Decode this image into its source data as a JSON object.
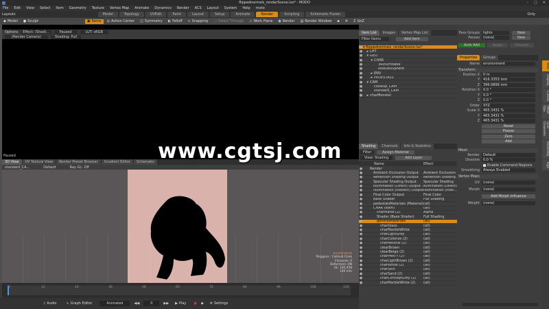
{
  "window": {
    "title": "flippednormals_renderScene.lxo* - MODO",
    "layouts_label": "Layouts",
    "layout_name": "Only",
    "controls": [
      "–",
      "□",
      "✕"
    ]
  },
  "menu": [
    "File",
    "Edit",
    "View",
    "Select",
    "Item",
    "Geometry",
    "Texture",
    "Vertex Map",
    "Animate",
    "Dynamics",
    "Render",
    "ACS",
    "Layout",
    "System",
    "Help",
    "moto"
  ],
  "layout_tabs": [
    "Model",
    "Topology",
    "UVEdit",
    "Paint",
    "Layout",
    "Setup",
    "Animate",
    "Render",
    "Scripting",
    "Schematic Fusion"
  ],
  "layout_tabs_active": "Render",
  "toolbar": {
    "model": "Model",
    "sculpt": "Sculpt",
    "items": "Items",
    "action_center": "Action Center",
    "symmetry": "Symmetry",
    "falloff": "Falloff",
    "snapping": "Snapping",
    "select_through": "Select Through",
    "work_plane": "Work Plane",
    "render": "Render",
    "render_window": "Render Window",
    "gof": "GoZ"
  },
  "render_view": {
    "options": "Options",
    "effect": "Effect: (Shadi...",
    "paused": "Paused",
    "lut": "LUT: sRGB",
    "camera": "(Render Camera)",
    "shading": "Shading: Full",
    "status": "Paused"
  },
  "watermark": "www.cgtsj.com",
  "view3d": {
    "tabs": [
      "3D View",
      "UV Texture View",
      "Render Preset Browser",
      "Gradient Editor",
      "Schematic"
    ],
    "cam": "standard_CA...",
    "default": "Default",
    "ray": "Ray GL: Off",
    "info": [
      "environment",
      "Polygons : Catmull-Clark",
      "Channels: 0",
      "Deformers: ON",
      "GL: 195,458",
      "100 mm"
    ]
  },
  "timeline": {
    "ticks": [
      "0",
      "12",
      "24",
      "36",
      "48",
      "60",
      "72",
      "84",
      "96",
      "108",
      "120"
    ],
    "audio": "Audio",
    "graph_editor": "Graph Editor",
    "animated": "Animated",
    "frame": "0",
    "play": "Play",
    "settings": "Settings"
  },
  "item_list": {
    "tabs": [
      "Item List",
      "Images",
      "Vertex Map List"
    ],
    "filter": "Filter Items",
    "add_item": "Add Item",
    "rows": [
      {
        "label": "flippednormals_renderScene.lxo*",
        "depth": 0,
        "arrow": "▾",
        "selected": true
      },
      {
        "label": "LHT",
        "depth": 1,
        "arrow": "▸",
        "selected": false
      },
      {
        "label": "GEO",
        "depth": 1,
        "arrow": "▾",
        "selected": false
      },
      {
        "label": "CHAR",
        "depth": 2,
        "arrow": "▾",
        "selected": false
      },
      {
        "label": "360turntable",
        "depth": 3,
        "arrow": "",
        "selected": false
      },
      {
        "label": "lookDevSphere",
        "depth": 3,
        "arrow": "",
        "selected": false
      },
      {
        "label": "ENV",
        "depth": 2,
        "arrow": "▸",
        "selected": false
      },
      {
        "label": "PEDESTALS",
        "depth": 2,
        "arrow": "▸",
        "selected": false
      },
      {
        "label": "CAM",
        "depth": 1,
        "arrow": "▾",
        "selected": false
      },
      {
        "label": "closeup_CAM",
        "depth": 2,
        "arrow": "",
        "selected": false
      },
      {
        "label": "standard_CAM",
        "depth": 2,
        "arrow": "",
        "selected": false
      },
      {
        "label": "charMonster",
        "depth": 1,
        "arrow": "▸",
        "selected": false
      }
    ]
  },
  "shading": {
    "tabs": [
      "Shading",
      "Channels",
      "Info & Statistics"
    ],
    "filter": "Filter",
    "view": "View: Shading",
    "assign_material": "Assign Material",
    "add_layer": "Add Layer",
    "col_name": "Name",
    "col_effect": "Effect",
    "rows": [
      {
        "name": "Render",
        "effect": "",
        "depth": 0,
        "sel": false
      },
      {
        "name": "Ambient Occlusion Output",
        "effect": "Ambient Occlusion",
        "depth": 1,
        "sel": false
      },
      {
        "name": "Reflection Shading Output",
        "effect": "Reflection Shading",
        "depth": 1,
        "sel": false
      },
      {
        "name": "Specular Shading Output",
        "effect": "Specular Shading",
        "depth": 1,
        "sel": false
      },
      {
        "name": "Illumination (Direct) Output",
        "effect": "Illumination (Direct)",
        "depth": 1,
        "sel": false
      },
      {
        "name": "Illumination (Indirect) Output",
        "effect": "Illumination (Indir...",
        "depth": 1,
        "sel": false
      },
      {
        "name": "Final Color Output",
        "effect": "Final Color",
        "depth": 1,
        "sel": false
      },
      {
        "name": "Base Shader",
        "effect": "Full Shading",
        "depth": 1,
        "sel": false
      },
      {
        "name": "pedestalsMaterials (Material)",
        "effect": "(all)",
        "depth": 1,
        "sel": false
      },
      {
        "name": "CHAR (Item)",
        "effect": "(all)",
        "depth": 1,
        "sel": false
      },
      {
        "name": "charMatte (2)",
        "effect": "Alpha",
        "depth": 2,
        "sel": false
      },
      {
        "name": "Shader (Base Shader)",
        "effect": "Full Shading",
        "depth": 2,
        "sel": false
      },
      {
        "name": "generalMaterials",
        "effect": "(all)",
        "depth": 2,
        "sel": true
      },
      {
        "name": "charGlass",
        "effect": "(all)",
        "depth": 3,
        "sel": false
      },
      {
        "name": "charMarbleWhite",
        "effect": "(all)",
        "depth": 3,
        "sel": false
      },
      {
        "name": "charLightGrey",
        "effect": "(all)",
        "depth": 3,
        "sel": false
      },
      {
        "name": "charColorize (2)",
        "effect": "(all)",
        "depth": 3,
        "sel": false
      },
      {
        "name": "charNeutral (2)",
        "effect": "(all)",
        "depth": 3,
        "sel": false
      },
      {
        "name": "clearBrown",
        "effect": "(all)",
        "depth": 3,
        "sel": false
      },
      {
        "name": "clearBeige (2)",
        "effect": "(all)",
        "depth": 3,
        "sel": false
      },
      {
        "name": "charPARTY (2)",
        "effect": "(all)",
        "depth": 3,
        "sel": false
      },
      {
        "name": "charLightBrown (2)",
        "effect": "(all)",
        "depth": 3,
        "sel": false
      },
      {
        "name": "charWhite (2)",
        "effect": "(all)",
        "depth": 3,
        "sel": false
      },
      {
        "name": "charSkin",
        "effect": "(all)",
        "depth": 3,
        "sel": false
      },
      {
        "name": "charSand (2)",
        "effect": "(all)",
        "depth": 3,
        "sel": false
      },
      {
        "name": "charConceptGrey (2)",
        "effect": "(all)",
        "depth": 3,
        "sel": false
      },
      {
        "name": "charMarbleWhite (2)",
        "effect": "(all)",
        "depth": 3,
        "sel": false
      }
    ]
  },
  "properties": {
    "pass_groups_label": "Pass Groups",
    "pass_groups_value": "lights",
    "passes_label": "Passes",
    "passes_value": "(none)",
    "new": "New",
    "auto_add": "Auto Add",
    "apply": "Apply",
    "discard": "Discard",
    "tabs": [
      "Properties",
      "Groups"
    ],
    "name_label": "Name",
    "name_value": "environment",
    "transform": "Transform",
    "position": [
      {
        "axis": "Position X",
        "value": "0 m"
      },
      {
        "axis": "Y",
        "value": "416.3353 mm"
      },
      {
        "axis": "Z",
        "value": "396.9899 mm"
      }
    ],
    "rotation": [
      {
        "axis": "Rotation X",
        "value": "0.0 °"
      },
      {
        "axis": "Y",
        "value": "0.0 °"
      },
      {
        "axis": "Z",
        "value": "0.0 °"
      }
    ],
    "order_label": "Order",
    "order_value": "XYZ",
    "scale": [
      {
        "axis": "Scale X",
        "value": "465.3431 %"
      },
      {
        "axis": "Y",
        "value": "465.3431 %"
      },
      {
        "axis": "Z",
        "value": "465.3431 %"
      }
    ],
    "buttons": [
      "Reset",
      "Freeze",
      "Zero",
      "Add"
    ],
    "mesh": "Mesh",
    "render_label": "Render",
    "render_value": "Default",
    "dissolve_label": "Dissolve",
    "dissolve_value": "0.0 %",
    "enable_cmd": "Enable Command Regions",
    "smoothing_label": "Smoothing",
    "smoothing_value": "Always Enabled",
    "vertex_maps": "Vertex Maps",
    "uv_label": "UV",
    "uv_value": "(none)",
    "morph_label": "Morph",
    "morph_value": "(none)",
    "add_morph": "Add Morph Influence",
    "weight_label": "Weight",
    "weight_value": "(none)",
    "side_tabs": [
      "Item",
      "Display",
      "Curves",
      "Mesh Ops",
      "User Channels",
      "Assembly",
      "Tags"
    ]
  }
}
